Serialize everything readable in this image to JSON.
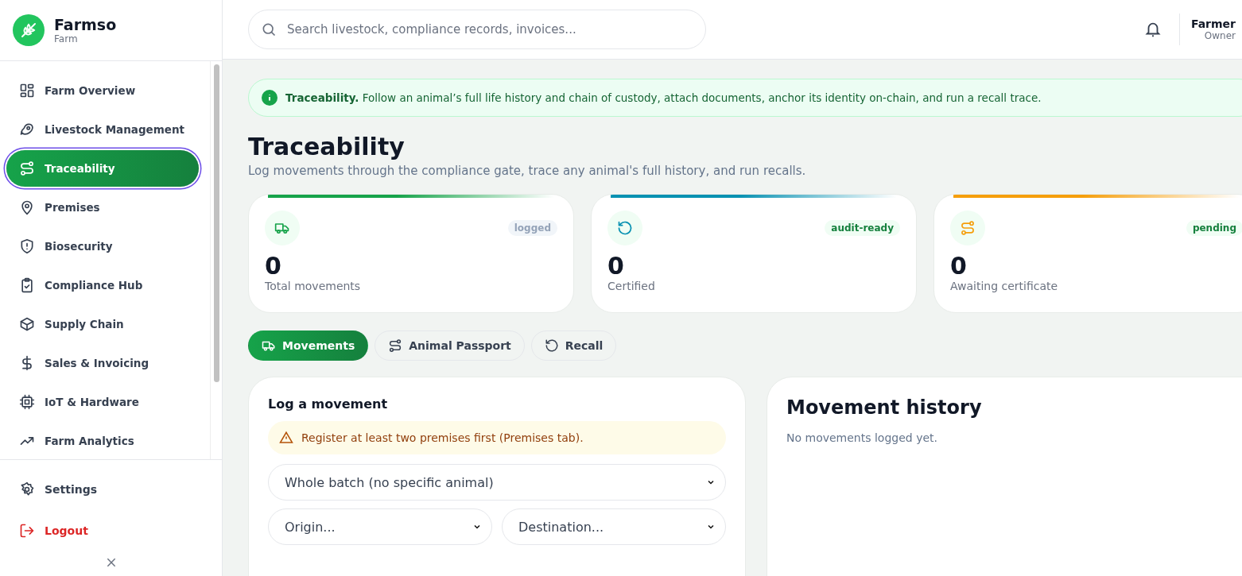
{
  "brand": {
    "name": "Farmso",
    "subtitle": "Farm"
  },
  "nav": [
    {
      "label": "Farm Overview",
      "kind": "grid",
      "selected": false
    },
    {
      "label": "Livestock Management",
      "kind": "meat",
      "selected": false
    },
    {
      "label": "Traceability",
      "kind": "route",
      "selected": true
    },
    {
      "label": "Premises",
      "kind": "pin",
      "selected": false
    },
    {
      "label": "Biosecurity",
      "kind": "shield",
      "selected": false
    },
    {
      "label": "Compliance Hub",
      "kind": "clipboard",
      "selected": false
    },
    {
      "label": "Supply Chain",
      "kind": "box",
      "selected": false
    },
    {
      "label": "Sales & Invoicing",
      "kind": "dollar",
      "selected": false
    },
    {
      "label": "IoT & Hardware",
      "kind": "chip",
      "selected": false
    },
    {
      "label": "Farm Analytics",
      "kind": "trend",
      "selected": false
    }
  ],
  "footer_nav": [
    {
      "label": "Settings",
      "kind": "settings"
    },
    {
      "label": "Logout",
      "kind": "logout"
    }
  ],
  "search": {
    "placeholder": "Search livestock, compliance records, invoices..."
  },
  "user": {
    "name": "Farmer",
    "role": "Owner"
  },
  "banner": {
    "text": "**Traceability.** Follow an animal’s full life history and chain of custody, attach documents, anchor its identity on-chain, and run a recall trace."
  },
  "page": {
    "title": "Traceability",
    "subtitle": "Log movements through the compliance gate, trace any animal's full history, and run recalls."
  },
  "stats": [
    {
      "value": "0",
      "label": "Total movements",
      "badge": "logged",
      "muted": true,
      "kind": "truck",
      "color": "#16a34a"
    },
    {
      "value": "0",
      "label": "Certified",
      "badge": "audit-ready",
      "muted": false,
      "kind": "rotate",
      "color": "#0891b2"
    },
    {
      "value": "0",
      "label": "Awaiting certificate",
      "badge": "pending",
      "muted": false,
      "kind": "route",
      "color": "#f59e0b"
    }
  ],
  "tabs": [
    {
      "label": "Movements",
      "kind": "truck",
      "selected": true
    },
    {
      "label": "Animal Passport",
      "kind": "route",
      "selected": false
    },
    {
      "label": "Recall",
      "kind": "rotate",
      "selected": false
    }
  ],
  "log_form": {
    "title": "Log a movement",
    "warning": "Register at least two premises first (Premises tab).",
    "animal_select": {
      "value": "Whole batch (no specific animal)"
    },
    "origin_select": {
      "value": "Origin..."
    },
    "destination_select": {
      "value": "Destination..."
    }
  },
  "history": {
    "title": "Movement history",
    "empty": "No movements logged yet."
  }
}
